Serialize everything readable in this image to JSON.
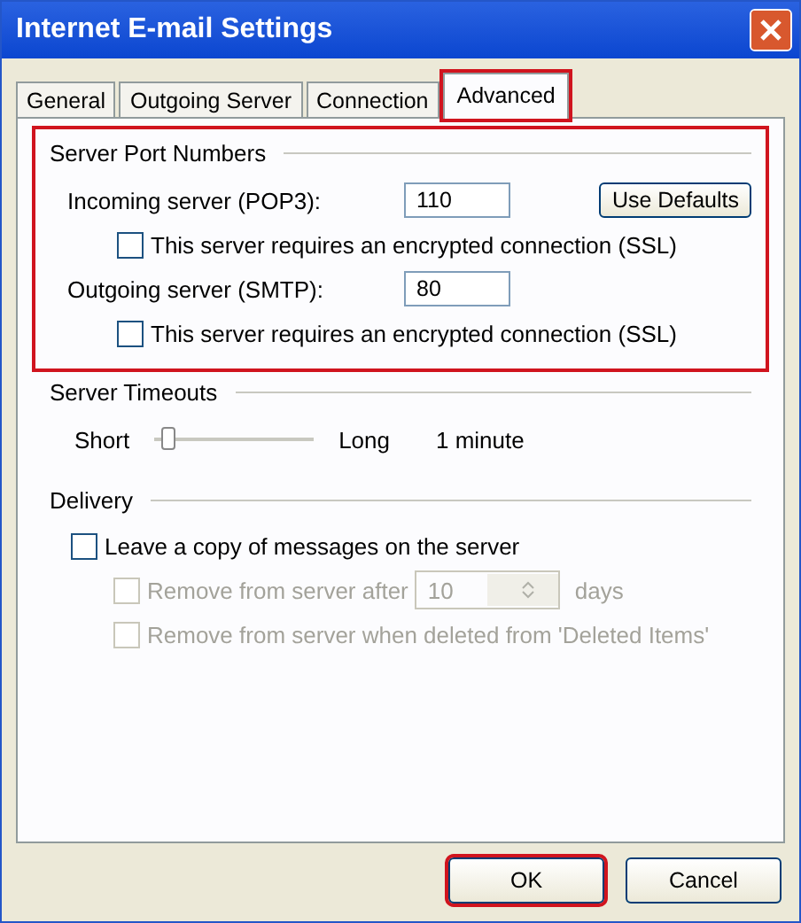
{
  "window": {
    "title": "Internet E-mail Settings"
  },
  "tabs": [
    {
      "label": "General",
      "selected": false,
      "highlighted": false
    },
    {
      "label": "Outgoing Server",
      "selected": false,
      "highlighted": false
    },
    {
      "label": "Connection",
      "selected": false,
      "highlighted": false
    },
    {
      "label": "Advanced",
      "selected": true,
      "highlighted": true
    }
  ],
  "ports": {
    "title": "Server Port Numbers",
    "highlighted": true,
    "incoming": {
      "label": "Incoming server (POP3):",
      "value": "110"
    },
    "incoming_ssl": {
      "label": "This server requires an encrypted connection (SSL)",
      "checked": false
    },
    "outgoing": {
      "label": "Outgoing server (SMTP):",
      "value": "80"
    },
    "outgoing_ssl": {
      "label": "This server requires an encrypted connection (SSL)",
      "checked": false
    },
    "defaults_button": "Use Defaults"
  },
  "timeouts": {
    "title": "Server Timeouts",
    "min_label": "Short",
    "max_label": "Long",
    "level": 0.05,
    "reading": "1 minute"
  },
  "delivery": {
    "title": "Delivery",
    "leave_copy": {
      "label": "Leave a copy of messages on the server",
      "checked": false,
      "disabled": false
    },
    "remove_after": {
      "label": "Remove from server after",
      "checked": false,
      "disabled": true,
      "value": "10",
      "unit": "days"
    },
    "remove_deleted": {
      "label": "Remove from server when deleted from 'Deleted Items'",
      "checked": false,
      "disabled": true
    }
  },
  "buttons": [
    {
      "label": "OK",
      "highlighted": true
    },
    {
      "label": "Cancel",
      "highlighted": false
    }
  ]
}
